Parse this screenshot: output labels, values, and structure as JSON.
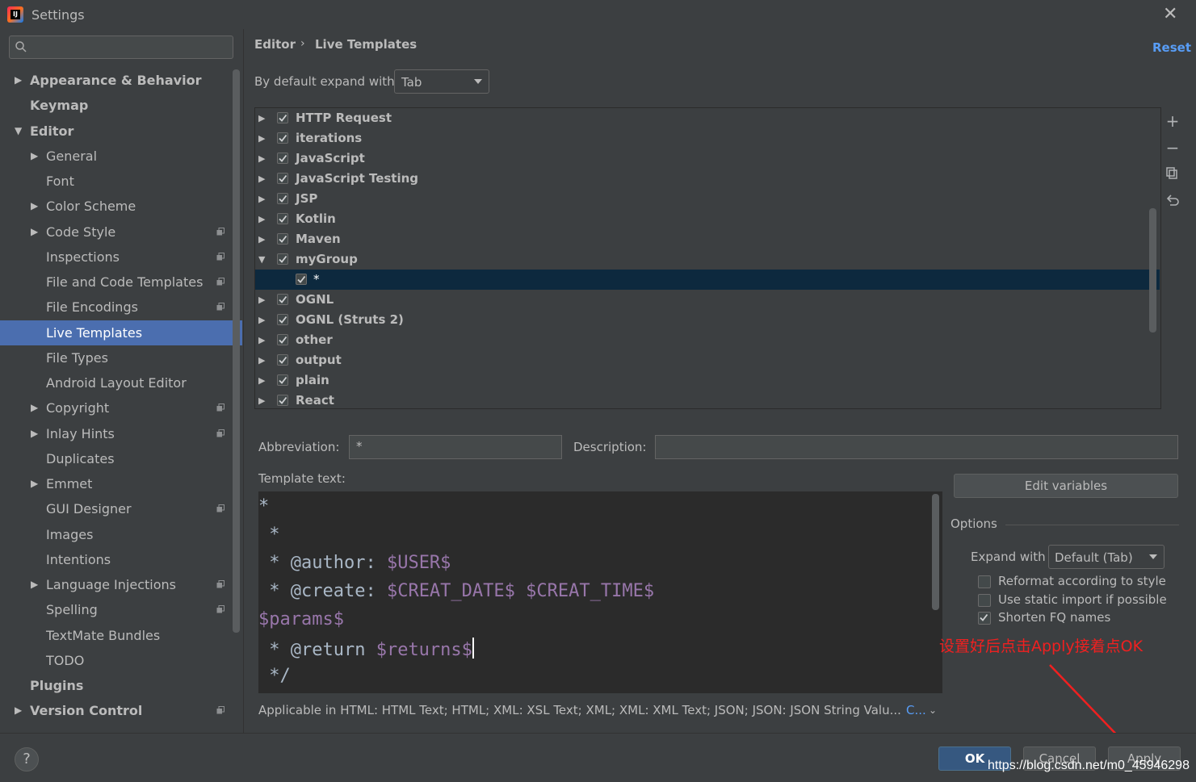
{
  "window": {
    "title": "Settings"
  },
  "sidebar": {
    "items": [
      {
        "label": "Appearance & Behavior",
        "level": 0,
        "arrow": "collapsed",
        "bold": true
      },
      {
        "label": "Keymap",
        "level": 0,
        "arrow": "none",
        "bold": true
      },
      {
        "label": "Editor",
        "level": 0,
        "arrow": "expanded",
        "bold": true
      },
      {
        "label": "General",
        "level": 1,
        "arrow": "collapsed"
      },
      {
        "label": "Font",
        "level": 1,
        "arrow": "none"
      },
      {
        "label": "Color Scheme",
        "level": 1,
        "arrow": "collapsed"
      },
      {
        "label": "Code Style",
        "level": 1,
        "arrow": "collapsed",
        "project_icon": true
      },
      {
        "label": "Inspections",
        "level": 1,
        "arrow": "none",
        "project_icon": true
      },
      {
        "label": "File and Code Templates",
        "level": 1,
        "arrow": "none",
        "project_icon": true
      },
      {
        "label": "File Encodings",
        "level": 1,
        "arrow": "none",
        "project_icon": true
      },
      {
        "label": "Live Templates",
        "level": 1,
        "arrow": "none",
        "selected": true
      },
      {
        "label": "File Types",
        "level": 1,
        "arrow": "none"
      },
      {
        "label": "Android Layout Editor",
        "level": 1,
        "arrow": "none"
      },
      {
        "label": "Copyright",
        "level": 1,
        "arrow": "collapsed",
        "project_icon": true
      },
      {
        "label": "Inlay Hints",
        "level": 1,
        "arrow": "collapsed",
        "project_icon": true
      },
      {
        "label": "Duplicates",
        "level": 1,
        "arrow": "none"
      },
      {
        "label": "Emmet",
        "level": 1,
        "arrow": "collapsed"
      },
      {
        "label": "GUI Designer",
        "level": 1,
        "arrow": "none",
        "project_icon": true
      },
      {
        "label": "Images",
        "level": 1,
        "arrow": "none"
      },
      {
        "label": "Intentions",
        "level": 1,
        "arrow": "none"
      },
      {
        "label": "Language Injections",
        "level": 1,
        "arrow": "collapsed",
        "project_icon": true
      },
      {
        "label": "Spelling",
        "level": 1,
        "arrow": "none",
        "project_icon": true
      },
      {
        "label": "TextMate Bundles",
        "level": 1,
        "arrow": "none"
      },
      {
        "label": "TODO",
        "level": 1,
        "arrow": "none"
      },
      {
        "label": "Plugins",
        "level": 0,
        "arrow": "none",
        "bold": true
      },
      {
        "label": "Version Control",
        "level": 0,
        "arrow": "collapsed",
        "bold": true,
        "project_icon": true
      }
    ]
  },
  "header": {
    "breadcrumb": [
      "Editor",
      "Live Templates"
    ],
    "separator": "›",
    "reset_label": "Reset"
  },
  "expand": {
    "label": "By default expand with",
    "value": "Tab"
  },
  "tree": {
    "rows": [
      {
        "label": "HTTP Request",
        "checked": true,
        "arrow": "collapsed"
      },
      {
        "label": "iterations",
        "checked": true,
        "arrow": "collapsed"
      },
      {
        "label": "JavaScript",
        "checked": true,
        "arrow": "collapsed"
      },
      {
        "label": "JavaScript Testing",
        "checked": true,
        "arrow": "collapsed"
      },
      {
        "label": "JSP",
        "checked": true,
        "arrow": "collapsed"
      },
      {
        "label": "Kotlin",
        "checked": true,
        "arrow": "collapsed"
      },
      {
        "label": "Maven",
        "checked": true,
        "arrow": "collapsed"
      },
      {
        "label": "myGroup",
        "checked": true,
        "arrow": "expanded"
      },
      {
        "label": "*",
        "checked": true,
        "arrow": "none",
        "child": true,
        "selected": true
      },
      {
        "label": "OGNL",
        "checked": true,
        "arrow": "collapsed"
      },
      {
        "label": "OGNL (Struts 2)",
        "checked": true,
        "arrow": "collapsed"
      },
      {
        "label": "other",
        "checked": true,
        "arrow": "collapsed"
      },
      {
        "label": "output",
        "checked": true,
        "arrow": "collapsed"
      },
      {
        "label": "plain",
        "checked": true,
        "arrow": "collapsed"
      },
      {
        "label": "React",
        "checked": true,
        "arrow": "collapsed"
      }
    ],
    "toolbar_icons": [
      "plus-icon",
      "minus-icon",
      "copy-icon",
      "undo-icon"
    ]
  },
  "form": {
    "abbreviation_label": "Abbreviation:",
    "abbreviation_value": "*",
    "description_label": "Description:",
    "description_value": "",
    "template_label": "Template text:",
    "template_lines": [
      {
        "prefix": "*",
        "var": "",
        "suffix": ""
      },
      {
        "prefix": " *",
        "var": "",
        "suffix": ""
      },
      {
        "prefix": " * @author: ",
        "var": "$USER$",
        "suffix": ""
      },
      {
        "prefix": " * @create: ",
        "var": "$CREAT_DATE$ $CREAT_TIME$",
        "suffix": ""
      },
      {
        "prefix": "",
        "var": "$params$",
        "suffix": ""
      },
      {
        "prefix": " * @return ",
        "var": "$returns$",
        "suffix": "",
        "caret": true
      },
      {
        "prefix": " */",
        "var": "",
        "suffix": ""
      }
    ],
    "edit_variables_label": "Edit variables",
    "applicable_text": "Applicable in HTML: HTML Text; HTML; XML: XSL Text; XML; XML: XML Text; JSON; JSON: JSON String Valu...",
    "change_link": "C..."
  },
  "options": {
    "title": "Options",
    "expand_with_label": "Expand with",
    "expand_with_value": "Default (Tab)",
    "checkboxes": [
      {
        "label": "Reformat according to style",
        "checked": false
      },
      {
        "label": "Use static import if possible",
        "checked": false
      },
      {
        "label": "Shorten FQ names",
        "checked": true
      }
    ]
  },
  "annotation": {
    "text": "设置好后点击Apply接着点OK",
    "color": "#f02020"
  },
  "footer": {
    "help_label": "?",
    "ok_label": "OK",
    "cancel_label": "Cancel",
    "apply_label": "Apply",
    "watermark": "https://blog.csdn.net/m0_45946298"
  },
  "colors": {
    "background": "#3c3f41",
    "selection": "#4b6eaf",
    "tree_selection": "#0d293e",
    "link": "#589df6",
    "template_var": "#9876aa"
  }
}
